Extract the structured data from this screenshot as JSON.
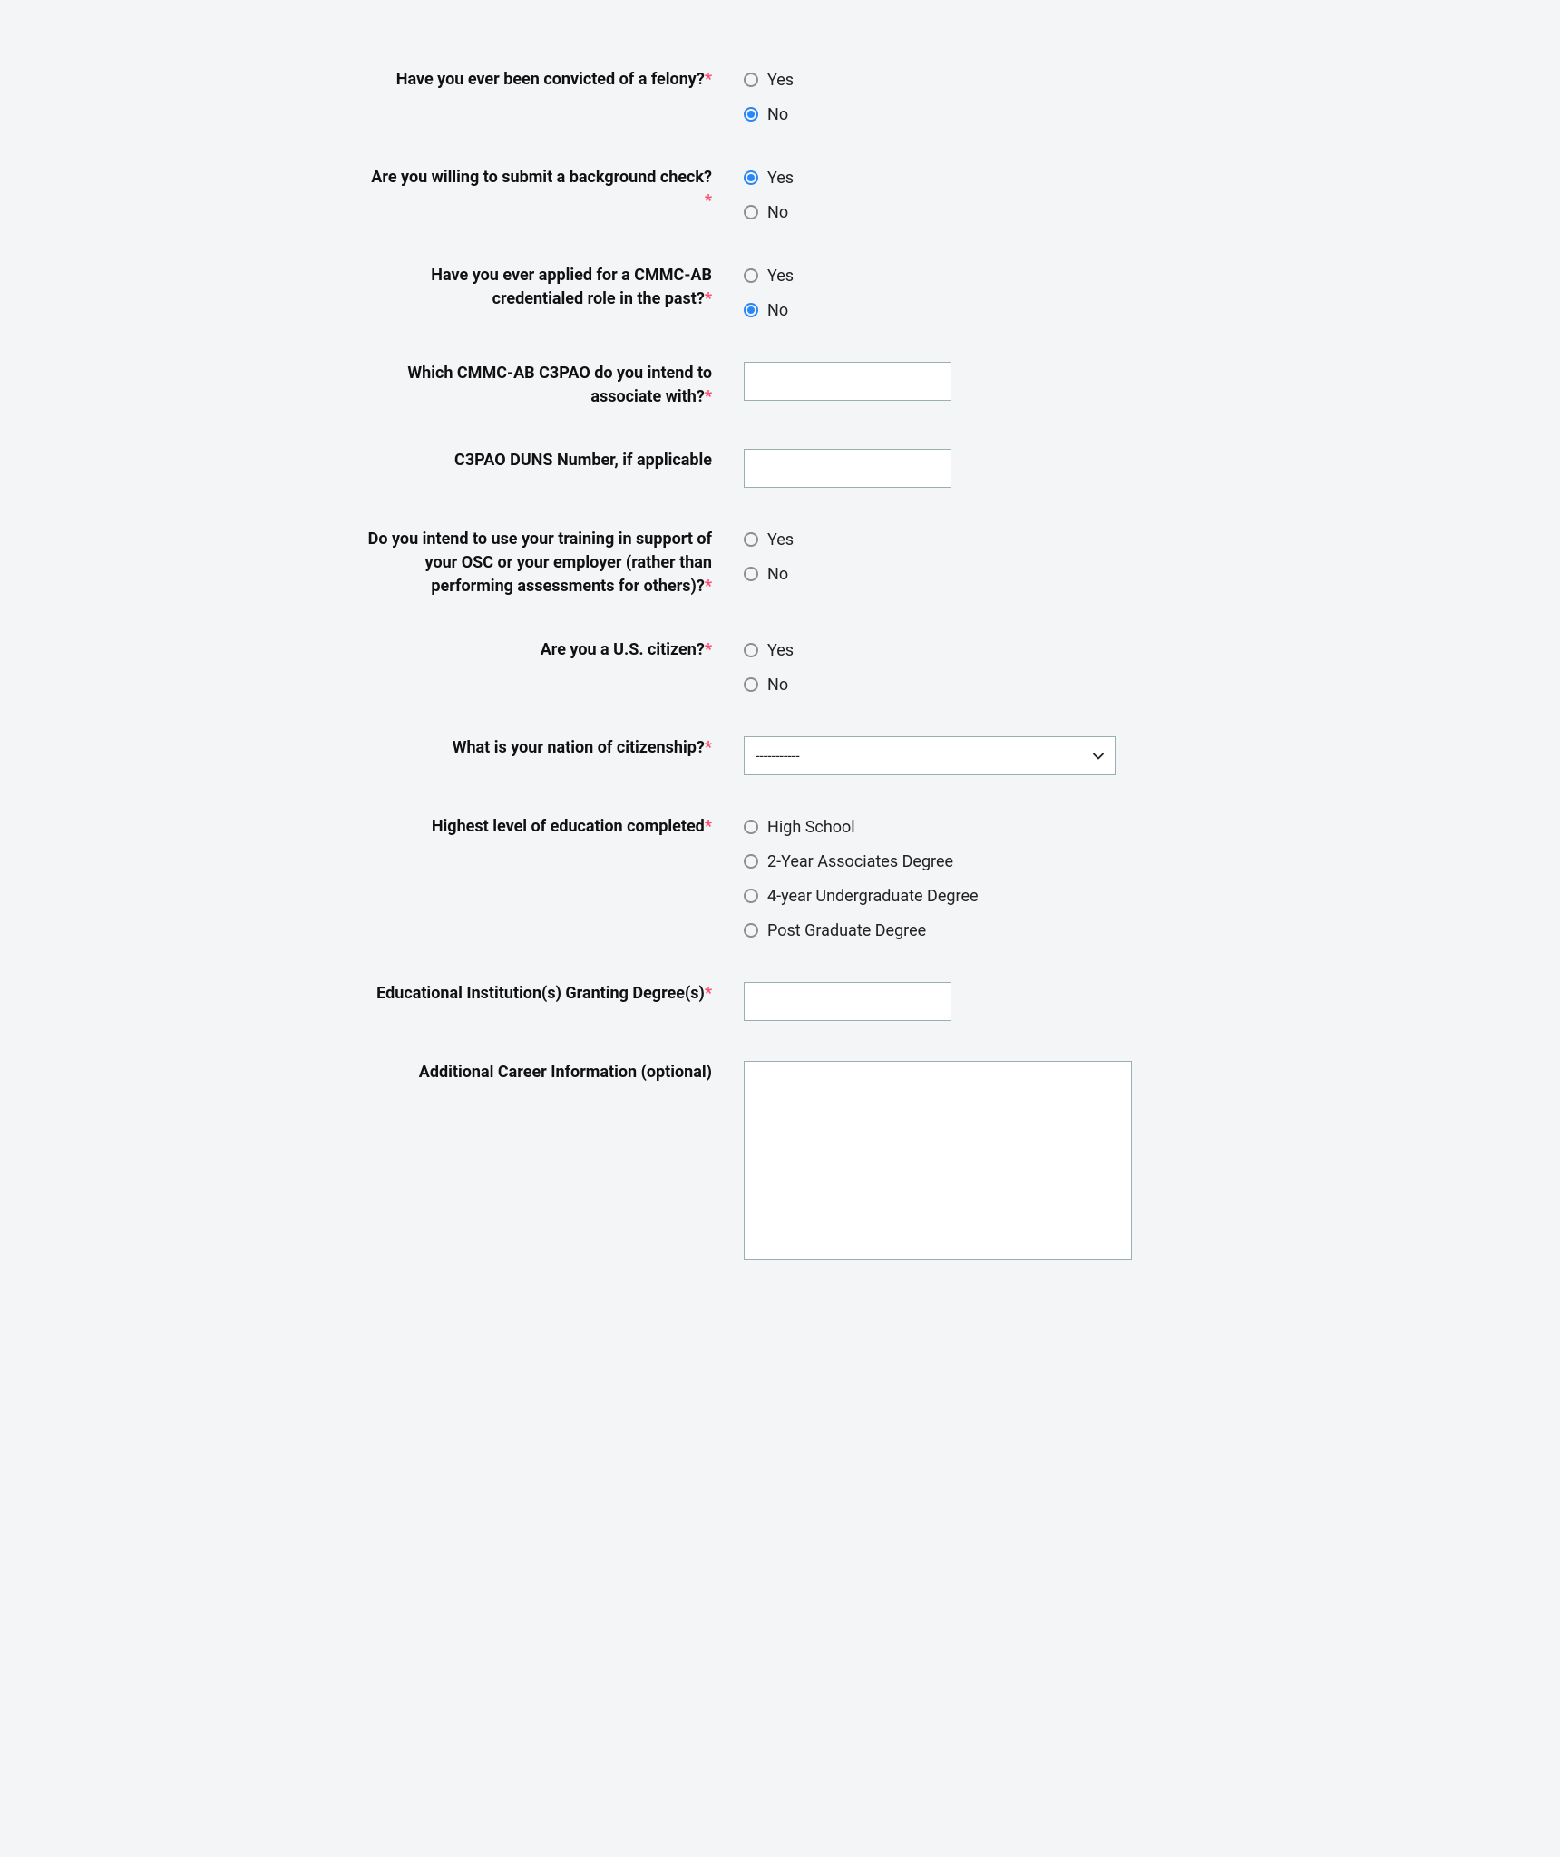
{
  "questions": {
    "q1": {
      "label": "Have you ever been convicted of a felony?",
      "required": true,
      "options": [
        "Yes",
        "No"
      ],
      "selected": "No"
    },
    "q2": {
      "label": "Are you willing to submit a background check?",
      "required": true,
      "options": [
        "Yes",
        "No"
      ],
      "selected": "Yes"
    },
    "q3": {
      "label": "Have you ever applied for a CMMC-AB credentialed role in the past?",
      "required": true,
      "options": [
        "Yes",
        "No"
      ],
      "selected": "No"
    },
    "q4": {
      "label": "Which CMMC-AB C3PAO do you intend to associate with?",
      "required": true,
      "value": ""
    },
    "q5": {
      "label": "C3PAO DUNS Number, if applicable",
      "required": false,
      "value": ""
    },
    "q6": {
      "label": "Do you intend to use your training in support of your OSC or your employer (rather than performing assessments for others)?",
      "required": true,
      "options": [
        "Yes",
        "No"
      ],
      "selected": ""
    },
    "q7": {
      "label": "Are you a U.S. citizen?",
      "required": true,
      "options": [
        "Yes",
        "No"
      ],
      "selected": ""
    },
    "q8": {
      "label": "What is your nation of citizenship?",
      "required": true,
      "selected_display": "-----------"
    },
    "q9": {
      "label": "Highest level of education completed",
      "required": true,
      "options": [
        "High School",
        "2-Year Associates Degree",
        "4-year Undergraduate Degree",
        "Post Graduate Degree"
      ],
      "selected": ""
    },
    "q10": {
      "label": "Educational Institution(s) Granting Degree(s)",
      "required": true,
      "value": ""
    },
    "q11": {
      "label": "Additional Career Information (optional)",
      "required": false,
      "value": ""
    }
  },
  "asterisk": "*"
}
